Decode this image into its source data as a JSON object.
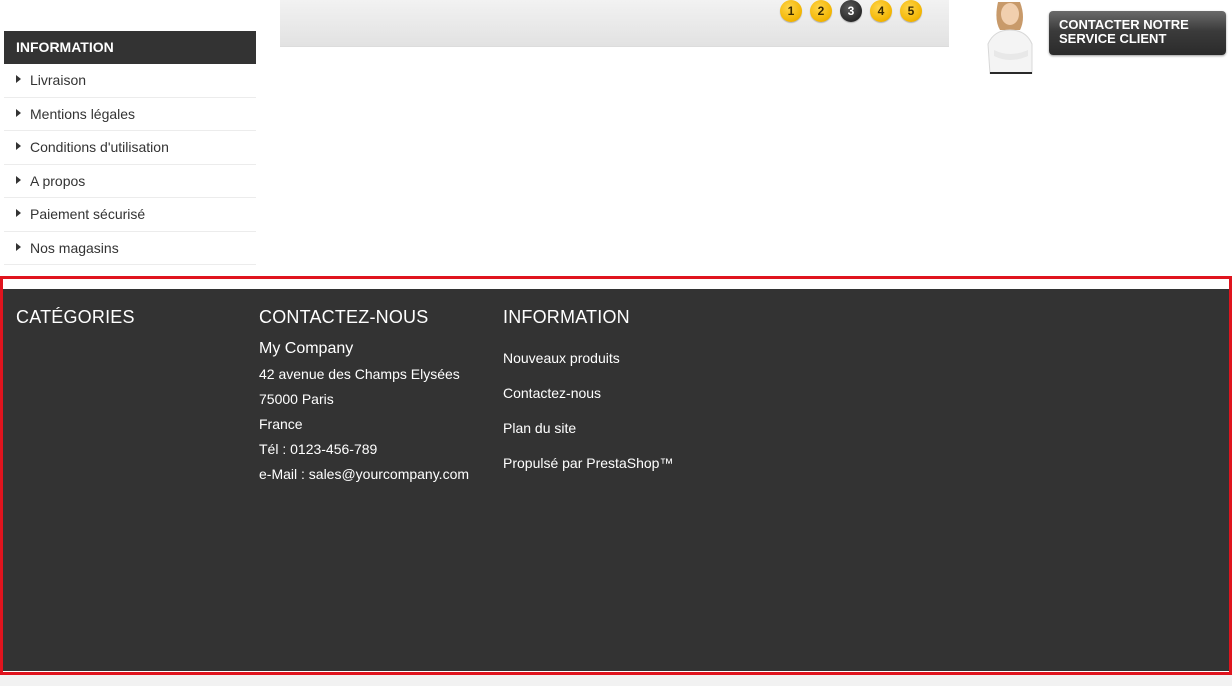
{
  "sidebar": {
    "title": "INFORMATION",
    "items": [
      {
        "label": "Livraison"
      },
      {
        "label": "Mentions légales"
      },
      {
        "label": "Conditions d'utilisation"
      },
      {
        "label": "A propos"
      },
      {
        "label": "Paiement sécurisé"
      },
      {
        "label": "Nos magasins"
      }
    ]
  },
  "slider": {
    "pages": [
      "1",
      "2",
      "3",
      "4",
      "5"
    ],
    "active_page": "3"
  },
  "customer_service": {
    "line1": "CONTACTER NOTRE",
    "line2": "SERVICE CLIENT"
  },
  "footer": {
    "categories": {
      "heading": "CATÉGORIES"
    },
    "contact": {
      "heading": "CONTACTEZ-NOUS",
      "company": "My Company",
      "address": "42 avenue des Champs Elysées",
      "city": "75000 Paris",
      "country": "France",
      "phone": "Tél : 0123-456-789",
      "email": "e-Mail : sales@yourcompany.com"
    },
    "information": {
      "heading": "INFORMATION",
      "links": [
        {
          "label": "Nouveaux produits"
        },
        {
          "label": "Contactez-nous"
        },
        {
          "label": "Plan du site"
        },
        {
          "label": "Propulsé par PrestaShop™"
        }
      ]
    }
  },
  "colors": {
    "dark_bg": "#333333",
    "highlight_border": "#e0141e",
    "pager_gold": "#f2b400"
  }
}
